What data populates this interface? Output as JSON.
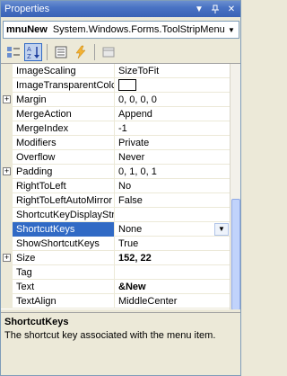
{
  "window": {
    "title": "Properties",
    "buttons": [
      "pin-dropdown",
      "auto-hide",
      "close"
    ]
  },
  "object_selector": {
    "name": "mnuNew",
    "type": "System.Windows.Forms.ToolStripMenuIte"
  },
  "toolbar": {
    "buttons": [
      {
        "name": "categorized-icon",
        "active": false
      },
      {
        "name": "alphabetical-icon",
        "active": true
      },
      {
        "name": "properties-icon",
        "active": false
      },
      {
        "name": "events-icon",
        "active": false
      },
      {
        "name": "property-pages-icon",
        "active": false
      }
    ]
  },
  "grid": {
    "rows": [
      {
        "name": "ImageScaling",
        "value": "SizeToFit"
      },
      {
        "name": "ImageTransparentColc",
        "value": "",
        "swatch": true
      },
      {
        "name": "Margin",
        "value": "0, 0, 0, 0",
        "expandable": true
      },
      {
        "name": "MergeAction",
        "value": "Append"
      },
      {
        "name": "MergeIndex",
        "value": "-1"
      },
      {
        "name": "Modifiers",
        "value": "Private"
      },
      {
        "name": "Overflow",
        "value": "Never"
      },
      {
        "name": "Padding",
        "value": "0, 1, 0, 1",
        "expandable": true
      },
      {
        "name": "RightToLeft",
        "value": "No"
      },
      {
        "name": "RightToLeftAutoMirror",
        "value": "False"
      },
      {
        "name": "ShortcutKeyDisplayStri",
        "value": ""
      },
      {
        "name": "ShortcutKeys",
        "value": "None",
        "selected": true,
        "dropdown": true
      },
      {
        "name": "ShowShortcutKeys",
        "value": "True"
      },
      {
        "name": "Size",
        "value": "152, 22",
        "expandable": true,
        "bold": true
      },
      {
        "name": "Tag",
        "value": ""
      },
      {
        "name": "Text",
        "value": "&New",
        "bold": true
      },
      {
        "name": "TextAlign",
        "value": "MiddleCenter"
      }
    ]
  },
  "description": {
    "title": "ShortcutKeys",
    "text": "The shortcut key associated with the menu item."
  },
  "colors": {
    "selection": "#316ac5",
    "title_bar": "#4a73c4",
    "panel_bg": "#ece9d8"
  }
}
